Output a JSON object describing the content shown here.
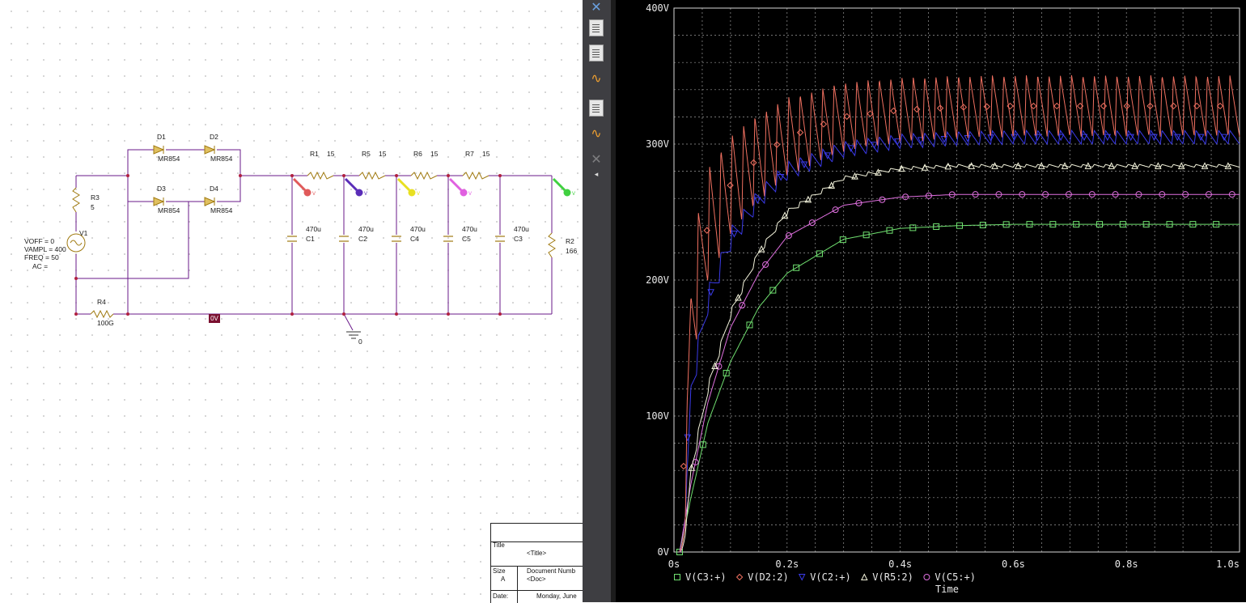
{
  "schematic": {
    "source": {
      "name": "V1",
      "params": [
        "VOFF = 0",
        "VAMPL = 400",
        "FREQ = 50",
        "AC ="
      ]
    },
    "resistors": [
      {
        "ref": "R3",
        "value": "5"
      },
      {
        "ref": "R4",
        "value": "100G"
      },
      {
        "ref": "R1",
        "value": "15"
      },
      {
        "ref": "R5",
        "value": "15"
      },
      {
        "ref": "R6",
        "value": "15"
      },
      {
        "ref": "R7",
        "value": "15"
      },
      {
        "ref": "R2",
        "value": "166"
      }
    ],
    "diodes": [
      {
        "ref": "D1",
        "model": "MR854"
      },
      {
        "ref": "D2",
        "model": "MR854"
      },
      {
        "ref": "D3",
        "model": "MR854"
      },
      {
        "ref": "D4",
        "model": "MR854"
      }
    ],
    "capacitors": [
      {
        "ref": "C1",
        "value": "470u"
      },
      {
        "ref": "C2",
        "value": "470u"
      },
      {
        "ref": "C4",
        "value": "470u"
      },
      {
        "ref": "C5",
        "value": "470u"
      },
      {
        "ref": "C3",
        "value": "470u"
      }
    ],
    "probes": [
      {
        "label": "V",
        "color": "#e05a5a"
      },
      {
        "label": "V",
        "color": "#5a2db8"
      },
      {
        "label": "V",
        "color": "#e8e020"
      },
      {
        "label": "V",
        "color": "#e060e0"
      },
      {
        "label": "V",
        "color": "#40d040"
      }
    ],
    "ground_label": "0",
    "node_badge": "0V",
    "wire_color": "#6a1a8a"
  },
  "titleblock": {
    "title_caption": "Title",
    "title_value": "<Title>",
    "size_caption": "Size",
    "size_value": "A",
    "docnum_caption": "Document Numb",
    "docnum_value": "<Doc>",
    "date_caption": "Date:",
    "date_value": "Monday, June"
  },
  "toolbar": {
    "icons": [
      "pin-icon",
      "pspice-sim-profile-icon",
      "waveform-doc-icon",
      "waveform-search-icon",
      "window-cascade-icon",
      "waveform-marker-icon",
      "clear-probes-icon",
      "collapse-arrow-icon"
    ]
  },
  "chart_data": {
    "type": "line",
    "xlabel": "Time",
    "ylabel": "",
    "xlim": [
      0,
      1.0
    ],
    "ylim": [
      0,
      400
    ],
    "x_ticks": [
      "0s",
      "0.2s",
      "0.4s",
      "0.6s",
      "0.8s",
      "1.0s"
    ],
    "y_ticks": [
      "0V",
      "100V",
      "200V",
      "300V",
      "400V"
    ],
    "grid": true,
    "legend_position": "bottom",
    "series": [
      {
        "name": "V(C3:+)",
        "color": "#70e070",
        "marker": "square",
        "x": [
          0.01,
          0.03,
          0.06,
          0.1,
          0.15,
          0.2,
          0.3,
          0.4,
          0.5,
          0.6,
          0.8,
          1.0
        ],
        "y": [
          0,
          40,
          95,
          140,
          180,
          205,
          230,
          238,
          240,
          241,
          241,
          241
        ]
      },
      {
        "name": "V(D2:2)",
        "color": "#f07060",
        "marker": "diamond",
        "ripple": {
          "freq_hz": 50,
          "amp_early": 100,
          "amp_late": 45
        },
        "x": [
          0.01,
          0.03,
          0.06,
          0.1,
          0.15,
          0.2,
          0.3,
          0.4,
          0.5,
          0.6,
          0.8,
          1.0
        ],
        "y": [
          0,
          180,
          240,
          270,
          290,
          305,
          320,
          325,
          327,
          328,
          328,
          328
        ]
      },
      {
        "name": "V(C2:+)",
        "color": "#3a3ae8",
        "marker": "triangle-down",
        "ripple": {
          "freq_hz": 50,
          "amp_early": 25,
          "amp_late": 10
        },
        "x": [
          0.01,
          0.03,
          0.06,
          0.1,
          0.15,
          0.2,
          0.3,
          0.4,
          0.5,
          0.6,
          0.8,
          1.0
        ],
        "y": [
          0,
          120,
          185,
          230,
          260,
          280,
          296,
          302,
          304,
          305,
          305,
          305
        ]
      },
      {
        "name": "V(R5:2)",
        "color": "#f4f4dc",
        "marker": "triangle-up",
        "ripple": {
          "freq_hz": 50,
          "amp_early": 10,
          "amp_late": 2
        },
        "x": [
          0.01,
          0.03,
          0.06,
          0.1,
          0.15,
          0.2,
          0.3,
          0.4,
          0.5,
          0.6,
          0.8,
          1.0
        ],
        "y": [
          0,
          60,
          120,
          175,
          220,
          250,
          275,
          282,
          284,
          284,
          284,
          284
        ]
      },
      {
        "name": "V(C5:+)",
        "color": "#e070e0",
        "marker": "circle",
        "x": [
          0.01,
          0.03,
          0.06,
          0.1,
          0.15,
          0.2,
          0.3,
          0.4,
          0.5,
          0.6,
          0.8,
          1.0
        ],
        "y": [
          0,
          50,
          110,
          165,
          205,
          232,
          255,
          261,
          263,
          263,
          263,
          263
        ]
      }
    ]
  }
}
